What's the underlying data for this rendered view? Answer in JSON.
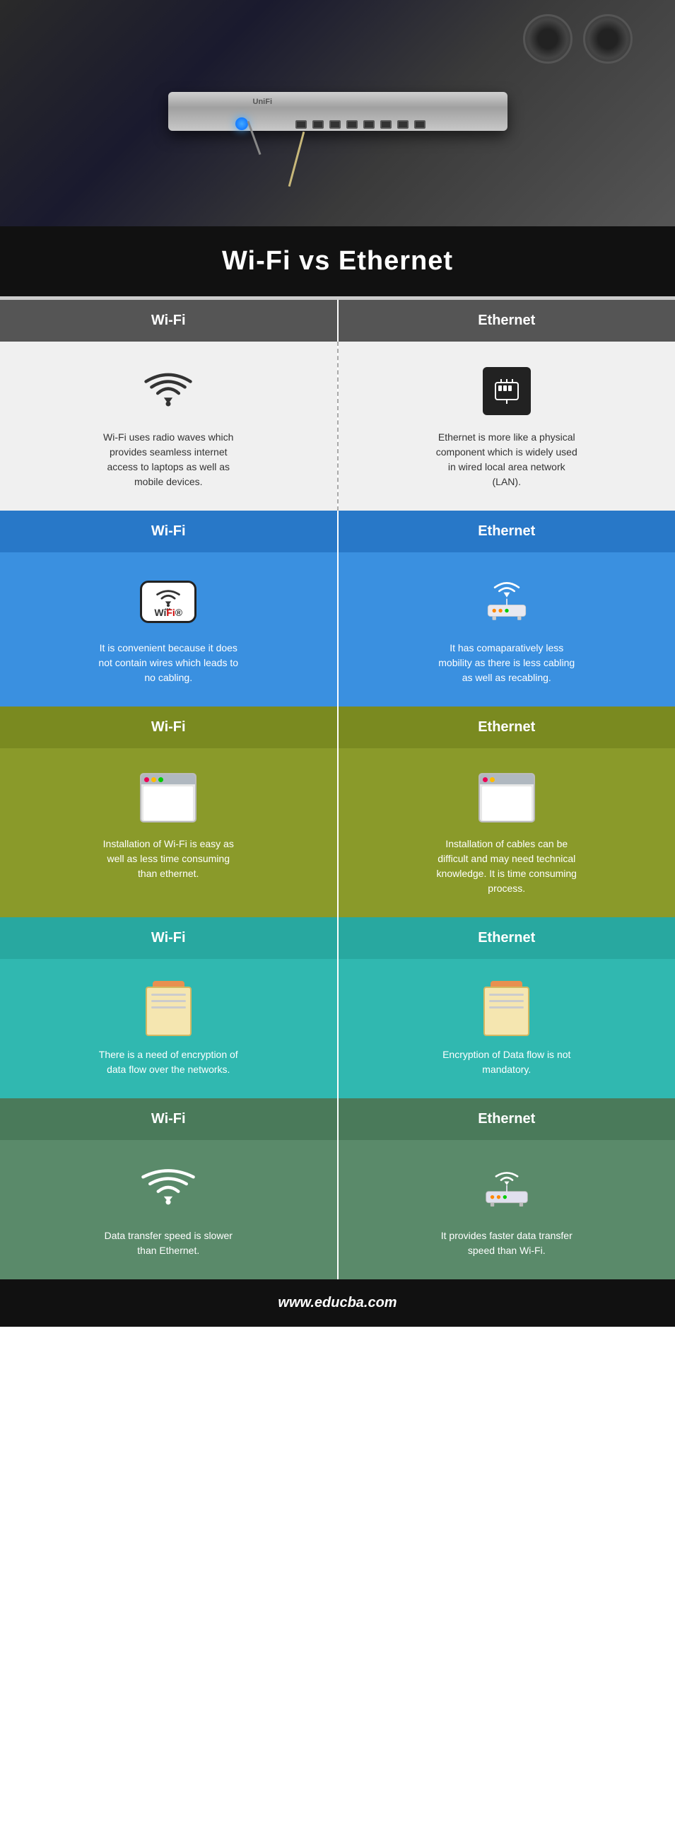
{
  "page": {
    "title": "Wi-Fi vs Ethernet Infographic",
    "footer_url": "www.educba.com"
  },
  "header": {
    "main_title": "Wi-Fi vs Ethernet"
  },
  "sections": [
    {
      "id": "section1",
      "header_left": "Wi-Fi",
      "header_right": "Ethernet",
      "header_color": "dark",
      "left_icon": "wifi",
      "right_icon": "ethernet-port",
      "left_text": "Wi-Fi uses radio waves which provides seamless internet access to laptops as well as mobile devices.",
      "right_text": "Ethernet is more like a physical component which is widely used in wired local area network (LAN).",
      "bg_color": "light-gray"
    },
    {
      "id": "section2",
      "header_left": "Wi-Fi",
      "header_right": "Ethernet",
      "header_color": "blue",
      "left_icon": "wifi-logo",
      "right_icon": "router",
      "left_text": "It is convenient because it does not contain wires which leads to no cabling.",
      "right_text": "It has comaparatively less mobility as there is less cabling as well as recabling.",
      "bg_color": "blue"
    },
    {
      "id": "section3",
      "header_left": "Wi-Fi",
      "header_right": "Ethernet",
      "header_color": "olive",
      "left_icon": "browser",
      "right_icon": "browser",
      "left_text": "Installation of Wi-Fi is easy as well as less time consuming than ethernet.",
      "right_text": "Installation of cables can be difficult and may need technical knowledge. It is time consuming process.",
      "bg_color": "olive"
    },
    {
      "id": "section4",
      "header_left": "Wi-Fi",
      "header_right": "Ethernet",
      "header_color": "teal",
      "left_icon": "notepad",
      "right_icon": "notepad",
      "left_text": "There is a need of encryption of data flow over the networks.",
      "right_text": "Encryption of Data flow is not mandatory.",
      "bg_color": "teal"
    },
    {
      "id": "section5",
      "header_left": "Wi-Fi",
      "header_right": "Ethernet",
      "header_color": "green-dark",
      "left_icon": "wifi-large",
      "right_icon": "router-small",
      "left_text": "Data transfer speed is slower than Ethernet.",
      "right_text": "It provides faster data transfer speed than Wi-Fi.",
      "bg_color": "green-dark"
    }
  ]
}
